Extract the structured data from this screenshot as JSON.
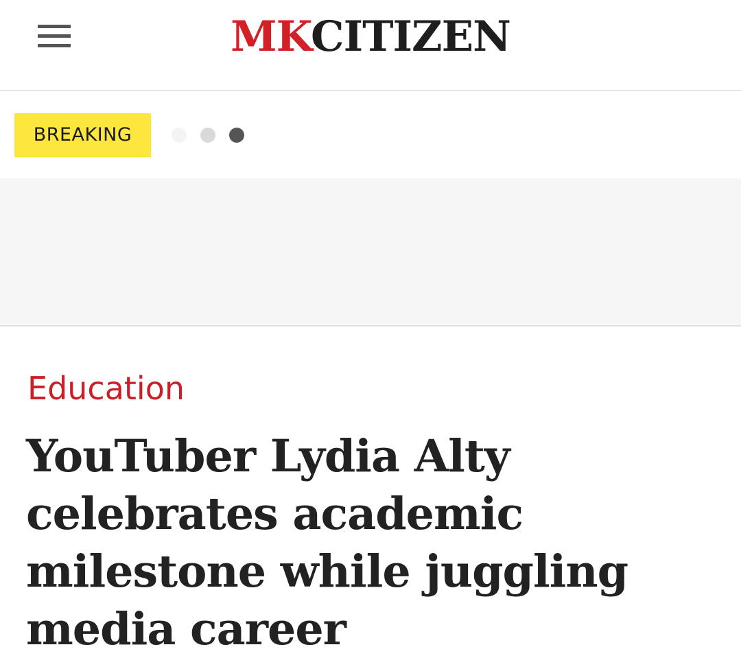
{
  "header": {
    "menu_icon": "hamburger-menu-icon",
    "logo_part1": "MK",
    "logo_part2": "CITIZEN",
    "logo_colors": {
      "mk": "#d31f26",
      "citizen": "#1e1e1e"
    }
  },
  "breaking": {
    "label": "BREAKING",
    "badge_color": "#fde73e",
    "carousel_total": 3,
    "carousel_active": 3
  },
  "article": {
    "category": "Education",
    "category_color": "#c92028",
    "headline": "YouTuber Lydia Alty celebrates academic milestone while juggling media career"
  }
}
